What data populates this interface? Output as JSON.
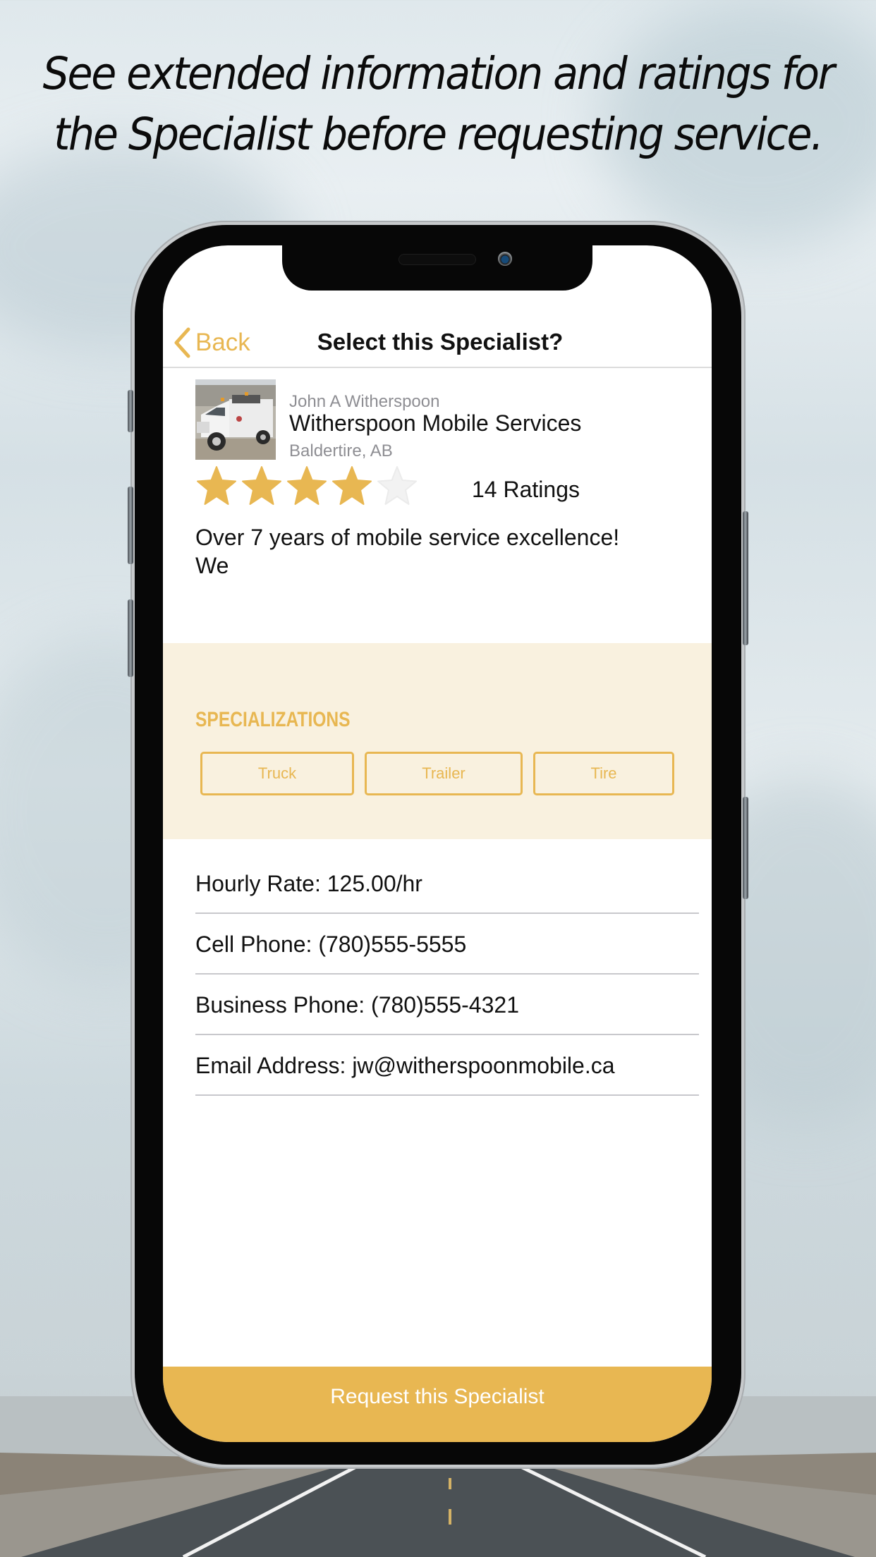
{
  "promo": {
    "headline_line1": "See extended information and ratings for",
    "headline_line2": "the Specialist before requesting service."
  },
  "nav": {
    "back_label": "Back",
    "back_icon": "chevron-left-icon",
    "title": "Select this Specialist?"
  },
  "specialist": {
    "owner_name": "John A Witherspoon",
    "business_name": "Witherspoon Mobile Services",
    "location": "Baldertire, AB",
    "photo_icon": "service-truck-photo",
    "rating": 4,
    "rating_max": 5,
    "ratings_count_label": "14 Ratings",
    "bio_line1": "Over 7 years of mobile service excellence!",
    "bio_line2": "We"
  },
  "specializations": {
    "title": "SPECIALIZATIONS",
    "items": [
      "Truck",
      "Trailer",
      "Tire"
    ]
  },
  "details": [
    {
      "label": "Hourly Rate:",
      "value": "125.00/hr"
    },
    {
      "label": "Cell Phone:",
      "value": "(780)555-5555"
    },
    {
      "label": "Business Phone:",
      "value": "(780)555-4321"
    },
    {
      "label": "Email Address:",
      "value": "jw@witherspoonmobile.ca"
    }
  ],
  "actions": {
    "request_label": "Request this Specialist"
  },
  "colors": {
    "accent": "#e8b752",
    "spec_background": "#f9f1df",
    "secondary_text": "#8e8e93",
    "empty_star": "#f2f2f2"
  }
}
